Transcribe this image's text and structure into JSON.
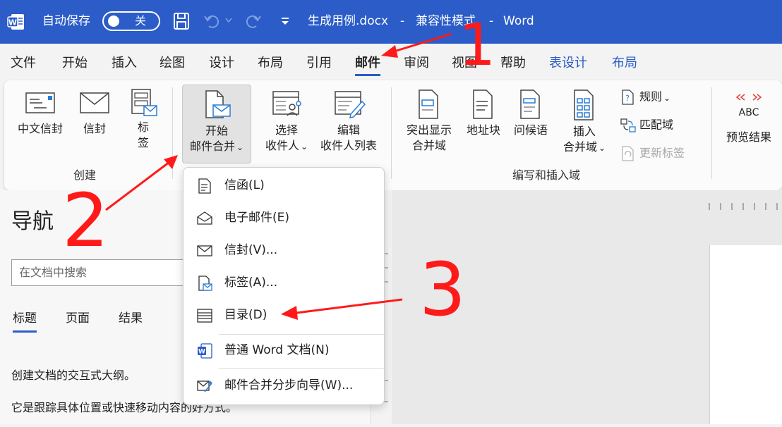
{
  "titlebar": {
    "autosave_label": "自动保存",
    "autosave_state": "关",
    "separator_symbol": "-",
    "filename": "生成用例.docx",
    "mode": "兼容性模式",
    "app_name": "Word",
    "bg_color": "#2b5cc8"
  },
  "tabs": [
    {
      "label": "文件"
    },
    {
      "label": "开始"
    },
    {
      "label": "插入"
    },
    {
      "label": "绘图"
    },
    {
      "label": "设计"
    },
    {
      "label": "布局"
    },
    {
      "label": "引用"
    },
    {
      "label": "邮件",
      "active": true
    },
    {
      "label": "审阅"
    },
    {
      "label": "视图"
    },
    {
      "label": "帮助"
    },
    {
      "label": "表设计",
      "contextual": true
    },
    {
      "label": "布局",
      "contextual": true
    }
  ],
  "ribbon": {
    "create_group": {
      "label": "创建",
      "buttons": {
        "chinese_envelope": "中文信封",
        "envelope": "信封",
        "labels_line1": "标",
        "labels_line2": "签"
      }
    },
    "start_group": {
      "start_merge_line1": "开始",
      "start_merge_line2": "邮件合并",
      "select_recipients_line1": "选择",
      "select_recipients_line2": "收件人",
      "edit_recipients_line1": "编辑",
      "edit_recipients_line2": "收件人列表"
    },
    "write_group": {
      "label": "编写和插入域",
      "highlight_line1": "突出显示",
      "highlight_line2": "合并域",
      "address_block": "地址块",
      "greeting_line": "问候语",
      "insert_field_line1": "插入",
      "insert_field_line2": "合并域",
      "rules": "规则",
      "match_fields": "匹配域",
      "update_labels": "更新标签"
    },
    "preview_group": {
      "preview_icon_text": "ABC",
      "preview_results": "预览结果"
    }
  },
  "menu": {
    "items": [
      {
        "label": "信函(L)",
        "icon": "letter-icon"
      },
      {
        "label": "电子邮件(E)",
        "icon": "email-message-icon"
      },
      {
        "label": "信封(V)...",
        "icon": "envelope-icon"
      },
      {
        "label": "标签(A)...",
        "icon": "label-icon"
      },
      {
        "label": "目录(D)",
        "icon": "directory-icon"
      },
      {
        "label": "普通 Word 文档(N)",
        "icon": "word-document-icon"
      },
      {
        "label": "邮件合并分步向导(W)...",
        "icon": "wizard-icon"
      }
    ]
  },
  "nav": {
    "title": "导航",
    "search_placeholder": "在文档中搜索",
    "tabs": [
      "标题",
      "页面",
      "结果"
    ],
    "line1": "创建文档的交互式大纲。",
    "line2": "它是跟踪具体位置或快速移动内容的好方式。"
  },
  "annotations": {
    "step1": "1",
    "step2": "2",
    "step3": "3",
    "color": "#ff1a1a"
  }
}
